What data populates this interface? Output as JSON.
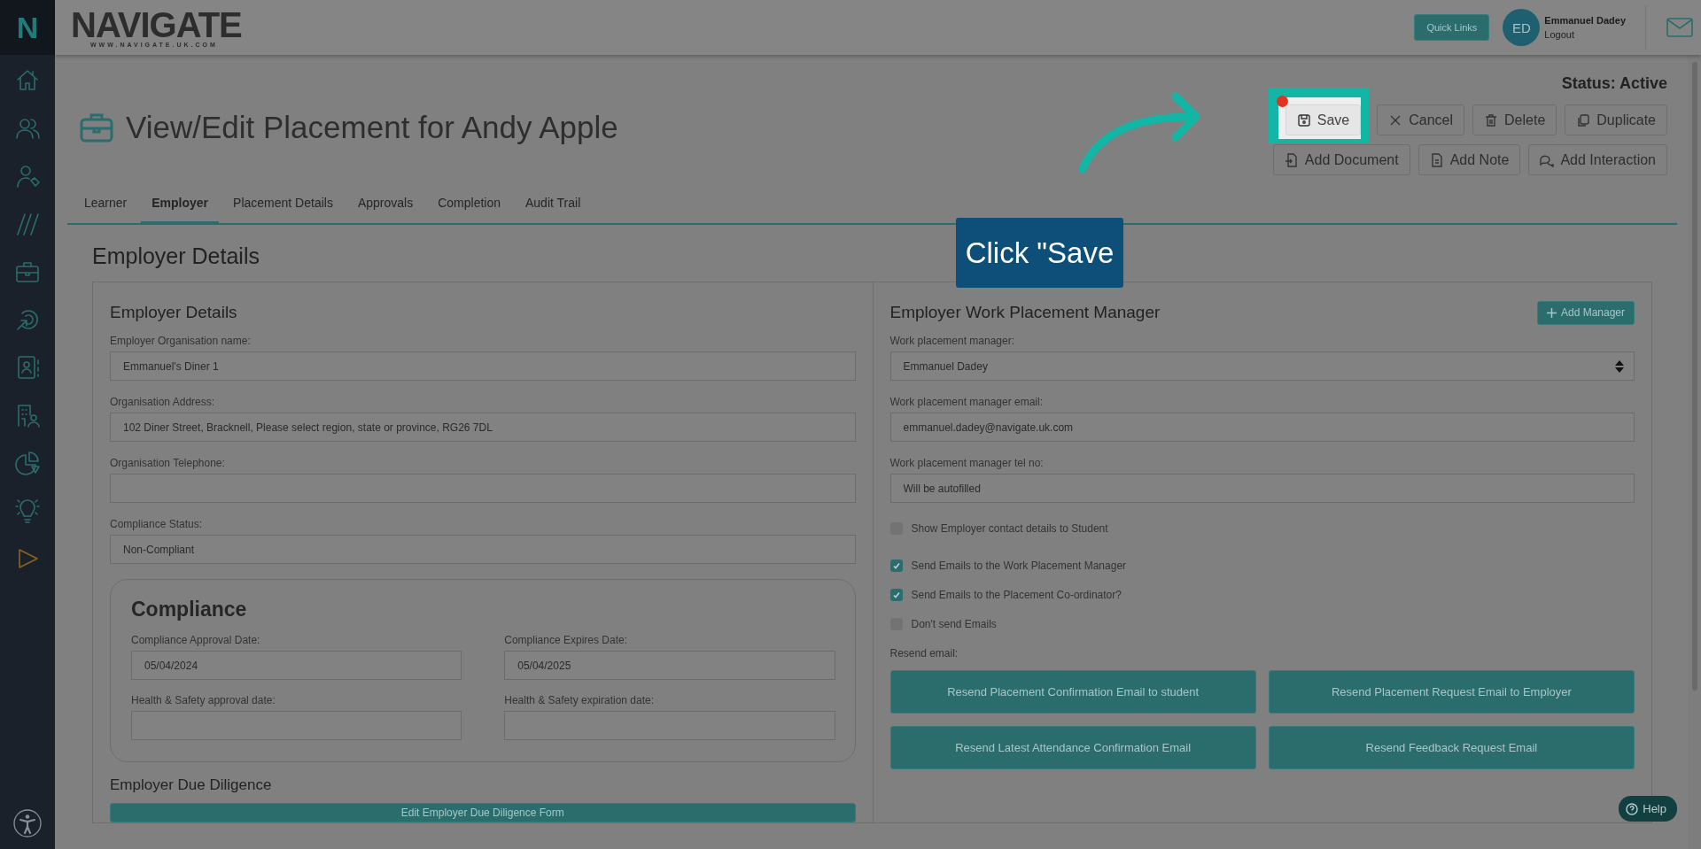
{
  "header": {
    "logo_mark": "N",
    "logo": "NAVIGATE",
    "logo_url": "WWW.NAVIGATE.UK.COM",
    "quick_links": "Quick Links",
    "user": {
      "initials": "ED",
      "name": "Emmanuel Dadey",
      "logout": "Logout"
    }
  },
  "page": {
    "title": "View/Edit Placement for Andy Apple",
    "status": "Status: Active",
    "actions": [
      {
        "label": "Save",
        "kind": "save",
        "highlighted": true
      },
      {
        "label": "Cancel",
        "kind": "cancel",
        "highlighted": false
      },
      {
        "label": "Delete",
        "kind": "delete",
        "highlighted": false
      },
      {
        "label": "Duplicate",
        "kind": "duplicate",
        "highlighted": false
      }
    ],
    "more_actions": [
      {
        "label": "Add Document",
        "kind": "document"
      },
      {
        "label": "Add Note",
        "kind": "note"
      },
      {
        "label": "Add Interaction",
        "kind": "interaction"
      }
    ]
  },
  "tabs": [
    {
      "label": "Learner",
      "selected": false
    },
    {
      "label": "Employer",
      "selected": true
    },
    {
      "label": "Placement Details",
      "selected": false
    },
    {
      "label": "Approvals",
      "selected": false
    },
    {
      "label": "Completion",
      "selected": false
    },
    {
      "label": "Audit Trail",
      "selected": false
    }
  ],
  "tutorial": {
    "callout": "Click \"Save"
  },
  "section_title": "Employer Details",
  "employer": {
    "title": "Employer Details",
    "fields": [
      {
        "label": "Employer Organisation name:",
        "value": "Emmanuel's Diner 1"
      },
      {
        "label": "Organisation Address:",
        "value": "102 Diner Street, Bracknell, Please select region, state or province, RG26 7DL"
      },
      {
        "label": "Organisation Telephone:"
      },
      {
        "label": "Compliance Status:",
        "value": "Non-Compliant"
      }
    ],
    "compliance": {
      "title": "Compliance",
      "fields": [
        {
          "label": "Compliance Approval Date:",
          "value": "05/04/2024"
        },
        {
          "label": "Compliance Expires Date:",
          "value": "05/04/2025"
        },
        {
          "label": "Health & Safety approval date:"
        },
        {
          "label": "Health & Safety expiration date:"
        }
      ]
    },
    "due_diligence": {
      "title": "Employer Due Diligence",
      "button": "Edit Employer Due Diligence Form"
    }
  },
  "manager": {
    "title": "Employer Work Placement Manager",
    "add_button": "Add Manager",
    "fields": [
      {
        "label": "Work placement manager:",
        "value": "Emmanuel Dadey",
        "kind": "select"
      },
      {
        "label": "Work placement manager email:",
        "value": "emmanuel.dadey@navigate.uk.com",
        "kind": "text"
      },
      {
        "label": "Work placement manager tel no:",
        "value": "Will be autofilled",
        "kind": "text"
      }
    ],
    "options": [
      {
        "label": "Show Employer contact details to Student",
        "checked": false
      },
      {
        "label": "Send Emails to the Work Placement Manager",
        "checked": true
      },
      {
        "label": "Send Emails to the Placement Co-ordinator?",
        "checked": true
      },
      {
        "label": "Don't send Emails",
        "checked": false
      }
    ],
    "resend_label": "Resend email:",
    "resend_buttons": [
      "Resend Placement Confirmation Email to student",
      "Resend Placement Request Email to Employer",
      "Resend Latest Attendance Confirmation Email",
      "Resend Feedback Request Email"
    ]
  },
  "help": "Help"
}
